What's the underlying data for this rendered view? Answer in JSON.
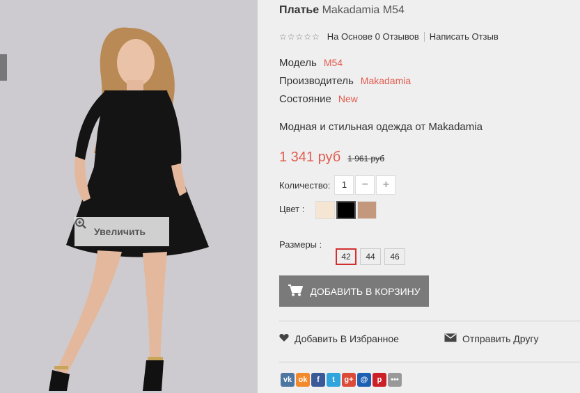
{
  "product": {
    "title_bold": "Платье",
    "title_rest": "Makadamia M54"
  },
  "rating": {
    "stars": "☆☆☆☆☆",
    "reviews": "На Основе 0 Отзывов",
    "write_review": "Написать Отзыв"
  },
  "specs": [
    {
      "label": "Модель",
      "value": "M54"
    },
    {
      "label": "Производитель",
      "value": "Makadamia"
    },
    {
      "label": "Состояние",
      "value": "New"
    }
  ],
  "description": "Модная и стильная одежда от Makadamia",
  "price": {
    "current": "1 341 руб",
    "old": "1 961 руб"
  },
  "quantity": {
    "label": "Количество:",
    "value": "1",
    "minus": "−",
    "plus": "+"
  },
  "color": {
    "label": "Цвет :",
    "swatches": [
      {
        "name": "beige",
        "hex": "#f5e6d3"
      },
      {
        "name": "black",
        "hex": "#000000"
      },
      {
        "name": "caramel",
        "hex": "#c4987c"
      }
    ]
  },
  "sizes": {
    "label": "Размеры :",
    "options": [
      "42",
      "44",
      "46"
    ],
    "selected": "42"
  },
  "cart_button": "ДОБАВИТЬ В КОРЗИНУ",
  "zoom_label": "Увеличить",
  "actions": {
    "wishlist": "Добавить В Избранное",
    "send_friend": "Отправить Другу"
  },
  "social": [
    {
      "name": "vk",
      "glyph": "vk",
      "color": "#4d76a1"
    },
    {
      "name": "odnoklassniki",
      "glyph": "ok",
      "color": "#f2892c"
    },
    {
      "name": "facebook",
      "glyph": "f",
      "color": "#3b5998"
    },
    {
      "name": "twitter",
      "glyph": "t",
      "color": "#2fa4dd"
    },
    {
      "name": "google-plus",
      "glyph": "g+",
      "color": "#dc4a38"
    },
    {
      "name": "mail-ru",
      "glyph": "@",
      "color": "#1e5fb3"
    },
    {
      "name": "pinterest",
      "glyph": "p",
      "color": "#cb2027"
    },
    {
      "name": "more",
      "glyph": "•••",
      "color": "#999999"
    }
  ]
}
